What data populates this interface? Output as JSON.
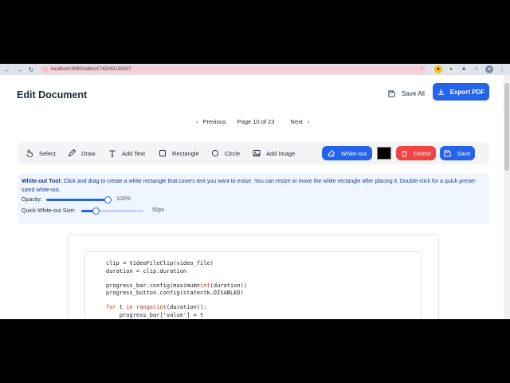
{
  "browser": {
    "url": "localhost:8080/editor/1742042150307"
  },
  "header": {
    "title": "Edit Document",
    "save_all_label": "Save All",
    "export_label": "Export PDF"
  },
  "pager": {
    "prev_label": "Previous",
    "page_label": "Page 10 of 23",
    "next_label": "Next"
  },
  "toolbar": {
    "select": "Select",
    "draw": "Draw",
    "add_text": "Add Text",
    "rectangle": "Rectangle",
    "circle": "Circle",
    "add_image": "Add Image",
    "white_out": "White-out",
    "color": "#000000",
    "delete": "Delete",
    "save": "Save"
  },
  "info": {
    "tool_name": "White-out Tool:",
    "description": " Click and drag to create a white rectangle that covers text you want to erase. You can resize or move the white rectangle after placing it. Double-click for a quick preset-sized white-out.",
    "opacity_label": "Opacity:",
    "opacity_value": "100%",
    "opacity_fraction": 1.0,
    "size_label": "Quick White-out Size:",
    "size_value": "50px"
  },
  "code_lines": [
    "clip = VideoFileClip(video_file)",
    "duration = clip.duration",
    "",
    "progress_bar.config(maximum=int(duration))",
    "progress_button.config(state=tk.DISABLED)",
    "",
    "for t in range(int(duration)):",
    "    progress_bar['value'] = t"
  ]
}
